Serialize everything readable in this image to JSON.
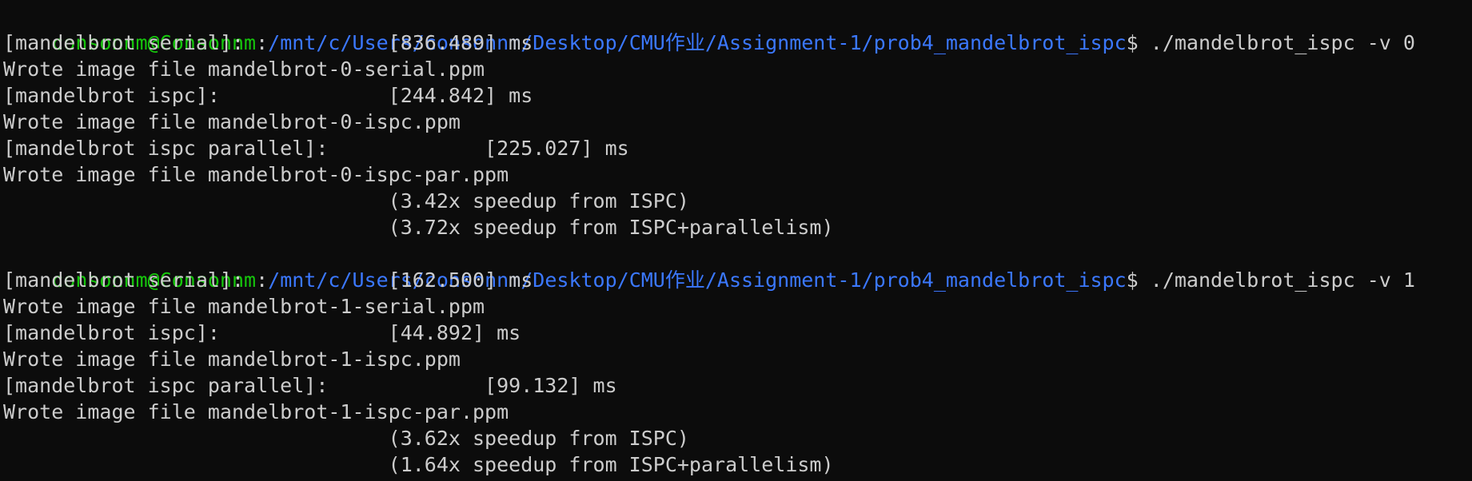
{
  "prompt": {
    "user_host": "consonnm@Consonnm",
    "separator": ":",
    "path": "/mnt/c/Users/consonnm/Desktop/CMU作业/Assignment-1/prob4_mandelbrot_ispc",
    "dollar": "$"
  },
  "colors": {
    "background": "#0c0c0c",
    "text": "#cccccc",
    "user_host": "#16c60c",
    "path": "#3b78ff"
  },
  "runs": [
    {
      "command": " ./mandelbrot_ispc -v 0",
      "output": [
        "[mandelbrot serial]:            [836.489] ms",
        "Wrote image file mandelbrot-0-serial.ppm",
        "[mandelbrot ispc]:              [244.842] ms",
        "Wrote image file mandelbrot-0-ispc.ppm",
        "[mandelbrot ispc parallel]:             [225.027] ms",
        "Wrote image file mandelbrot-0-ispc-par.ppm",
        "                                (3.42x speedup from ISPC)",
        "                                (3.72x speedup from ISPC+parallelism)"
      ]
    },
    {
      "command": " ./mandelbrot_ispc -v 1",
      "output": [
        "[mandelbrot serial]:            [162.500] ms",
        "Wrote image file mandelbrot-1-serial.ppm",
        "[mandelbrot ispc]:              [44.892] ms",
        "Wrote image file mandelbrot-1-ispc.ppm",
        "[mandelbrot ispc parallel]:             [99.132] ms",
        "Wrote image file mandelbrot-1-ispc-par.ppm",
        "                                (3.62x speedup from ISPC)",
        "                                (1.64x speedup from ISPC+parallelism)"
      ]
    }
  ]
}
